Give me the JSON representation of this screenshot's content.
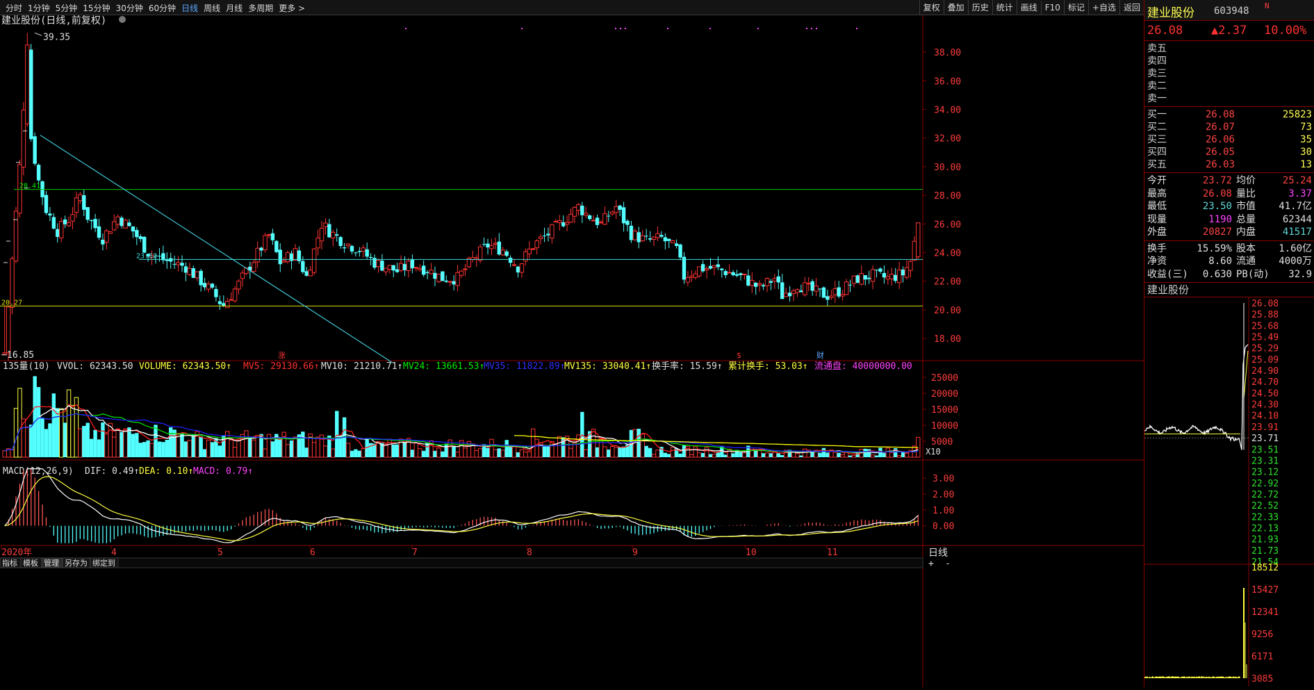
{
  "toolbar": {
    "periods": [
      "分时",
      "1分钟",
      "5分钟",
      "15分钟",
      "30分钟",
      "60分钟",
      "日线",
      "周线",
      "月线",
      "多周期",
      "更多 >"
    ],
    "active_period": "日线",
    "tools": [
      "复权",
      "叠加",
      "历史",
      "统计",
      "画线",
      "F10",
      "标记",
      "+自选",
      "返回"
    ]
  },
  "chart_header": {
    "title": "建业股份(日线,前复权)"
  },
  "price_axis": {
    "labels": [
      "38.00",
      "36.00",
      "34.00",
      "32.00",
      "30.00",
      "28.00",
      "26.00",
      "24.00",
      "22.00",
      "20.00",
      "18.00"
    ],
    "min": 16.5,
    "max": 39.8
  },
  "annotations": {
    "high_label": "39.35",
    "low_label": "16.85",
    "line_28": "28.41",
    "line_23": "23.52",
    "line_20": "20.27",
    "event_markers": [
      "涨",
      "$",
      "财"
    ]
  },
  "volume_header": {
    "name": "135量(10)",
    "vvol": "VVOL: 62343.50",
    "volume": "VOLUME: 62343.50↑",
    "mv5": "MV5: 29130.66↑",
    "mv10": "MV10: 21210.71↑",
    "mv24": "MV24: 13661.53↑",
    "mv35": "MV35: 11822.89↑",
    "mv135": "MV135: 33040.41↑",
    "turnover": "换手率: 15.59↑",
    "cum_turnover": "累计换手: 53.03↑",
    "float": "流通盘: 40000000.00"
  },
  "volume_axis": {
    "labels": [
      "25000",
      "20000",
      "15000",
      "10000",
      "5000"
    ],
    "unit": "X10",
    "max": 27000
  },
  "macd_header": {
    "name": "MACD(12,26,9)",
    "dif": "DIF: 0.49↑",
    "dea": "DEA: 0.10↑",
    "macd": "MACD: 0.79↑"
  },
  "macd_axis": {
    "labels": [
      "3.00",
      "2.00",
      "1.00",
      "0.00"
    ],
    "min": -1.2,
    "max": 3.8
  },
  "date_axis": {
    "labels": [
      "2020年",
      "4",
      "5",
      "6",
      "7",
      "8",
      "9",
      "10",
      "11"
    ],
    "period_label": "日线"
  },
  "bottom_tabs": [
    "指标",
    "模板",
    "管理",
    "另存为",
    "绑定到"
  ],
  "bottom_active": "管理",
  "zoom_buttons": [
    "+",
    "-"
  ],
  "quote": {
    "name": "建业股份",
    "code": "603948",
    "badge": "N",
    "price": "26.08",
    "change": "▲2.37",
    "pct": "10.00%"
  },
  "asks": [
    {
      "label": "卖五",
      "price": "",
      "vol": ""
    },
    {
      "label": "卖四",
      "price": "",
      "vol": ""
    },
    {
      "label": "卖三",
      "price": "",
      "vol": ""
    },
    {
      "label": "卖二",
      "price": "",
      "vol": ""
    },
    {
      "label": "卖一",
      "price": "",
      "vol": ""
    }
  ],
  "bids": [
    {
      "label": "买一",
      "price": "26.08",
      "vol": "25823"
    },
    {
      "label": "买二",
      "price": "26.07",
      "vol": "73"
    },
    {
      "label": "买三",
      "price": "26.06",
      "vol": "35"
    },
    {
      "label": "买四",
      "price": "26.05",
      "vol": "30"
    },
    {
      "label": "买五",
      "price": "26.03",
      "vol": "13"
    }
  ],
  "stats": [
    {
      "l1": "今开",
      "v1": "23.72",
      "l2": "均价",
      "v2": "25.24"
    },
    {
      "l1": "最高",
      "v1": "26.08",
      "l2": "量比",
      "v2": "3.37"
    },
    {
      "l1": "最低",
      "v1": "23.50",
      "l2": "市值",
      "v2": "41.7亿"
    },
    {
      "l1": "现量",
      "v1": "1190",
      "l2": "总量",
      "v2": "62344"
    },
    {
      "l1": "外盘",
      "v1": "20827",
      "l2": "内盘",
      "v2": "41517"
    }
  ],
  "stats2": [
    {
      "l1": "换手",
      "v1": "15.59%",
      "l2": "股本",
      "v2": "1.60亿"
    },
    {
      "l1": "净资",
      "v1": "8.60",
      "l2": "流通",
      "v2": "4000万"
    },
    {
      "l1": "收益(三)",
      "v1": "0.630",
      "l2": "PB(动)",
      "v2": "32.9"
    }
  ],
  "mini_chart": {
    "title": "建业股份",
    "price_labels": [
      "26.08",
      "25.88",
      "25.68",
      "25.49",
      "25.29",
      "25.09",
      "24.90",
      "24.70",
      "24.50",
      "24.30",
      "24.10",
      "23.91",
      "23.71",
      "23.51",
      "23.31",
      "23.12",
      "22.92",
      "22.72",
      "22.52",
      "22.33",
      "22.13",
      "21.93",
      "21.73",
      "21.54"
    ],
    "vol_labels": [
      "18512",
      "15427",
      "12341",
      "9256",
      "6171",
      "3085"
    ]
  },
  "colors": {
    "up": "#ff3333",
    "down": "#54ffff",
    "ma5": "#ff2020",
    "ma10": "#ffffff",
    "ma24": "#00dd00",
    "ma35": "#2020ff",
    "ma135": "#ffff00",
    "grid": "#8a0000"
  }
}
